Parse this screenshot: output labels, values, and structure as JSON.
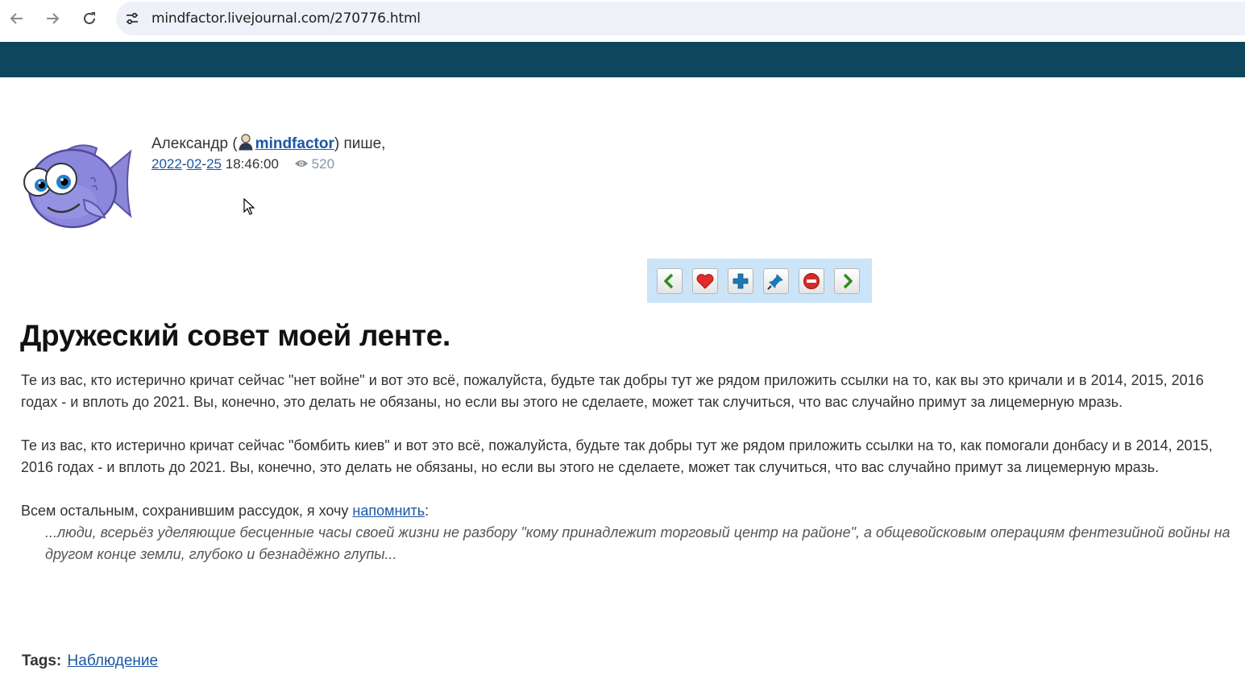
{
  "browser": {
    "url": "mindfactor.livejournal.com/270776.html"
  },
  "post": {
    "author_name": "Александр (",
    "username": "mindfactor",
    "writes": ") пише,",
    "date_year": "2022",
    "date_month": "02",
    "date_day": "25",
    "time": "18:46:00",
    "views": "520",
    "title": "Дружеский совет моей ленте.",
    "paragraph1": "Те из вас, кто истерично кричат сейчас \"нет войне\" и вот это всё, пожалуйста, будьте так добры тут же рядом приложить ссылки на то, как вы это кричали и в 2014, 2015, 2016 годах - и вплоть до 2021. Вы, конечно, это делать не обязаны, но если вы этого не сделаете, может так случиться, что вас случайно примут за лицемерную мразь.",
    "paragraph2": "Те из вас, кто истерично кричат сейчас \"бомбить киев\" и вот это всё, пожалуйста, будьте так добры тут же рядом приложить ссылки на то, как помогали донбасу и в 2014, 2015, 2016 годах - и вплоть до 2021. Вы, конечно, это делать не обязаны, но если вы этого не сделаете, может так случиться, что вас случайно примут за лицемерную мразь.",
    "paragraph3_prefix": "Всем остальным, сохранившим рассудок, я хочу ",
    "paragraph3_link": "напомнить",
    "paragraph3_suffix": ":",
    "quote": "...люди, всерьёз уделяющие бесценные часы своей жизни не разбору \"кому принадлежит торговый центр на районе\", а общевойсковым операциям фентезийной войны на другом конце земли, глубоко и безнадёжно глупы...",
    "tags_label": "Tags:",
    "tag": "Наблюдение"
  },
  "toolbar": {
    "buttons": [
      "prev-entry",
      "add-to-memories",
      "add-friend",
      "track-entry",
      "flag-entry",
      "next-entry"
    ]
  },
  "colors": {
    "header": "#10465d",
    "link": "#1b57a5",
    "toolbar_bg": "#cbe4f8"
  }
}
